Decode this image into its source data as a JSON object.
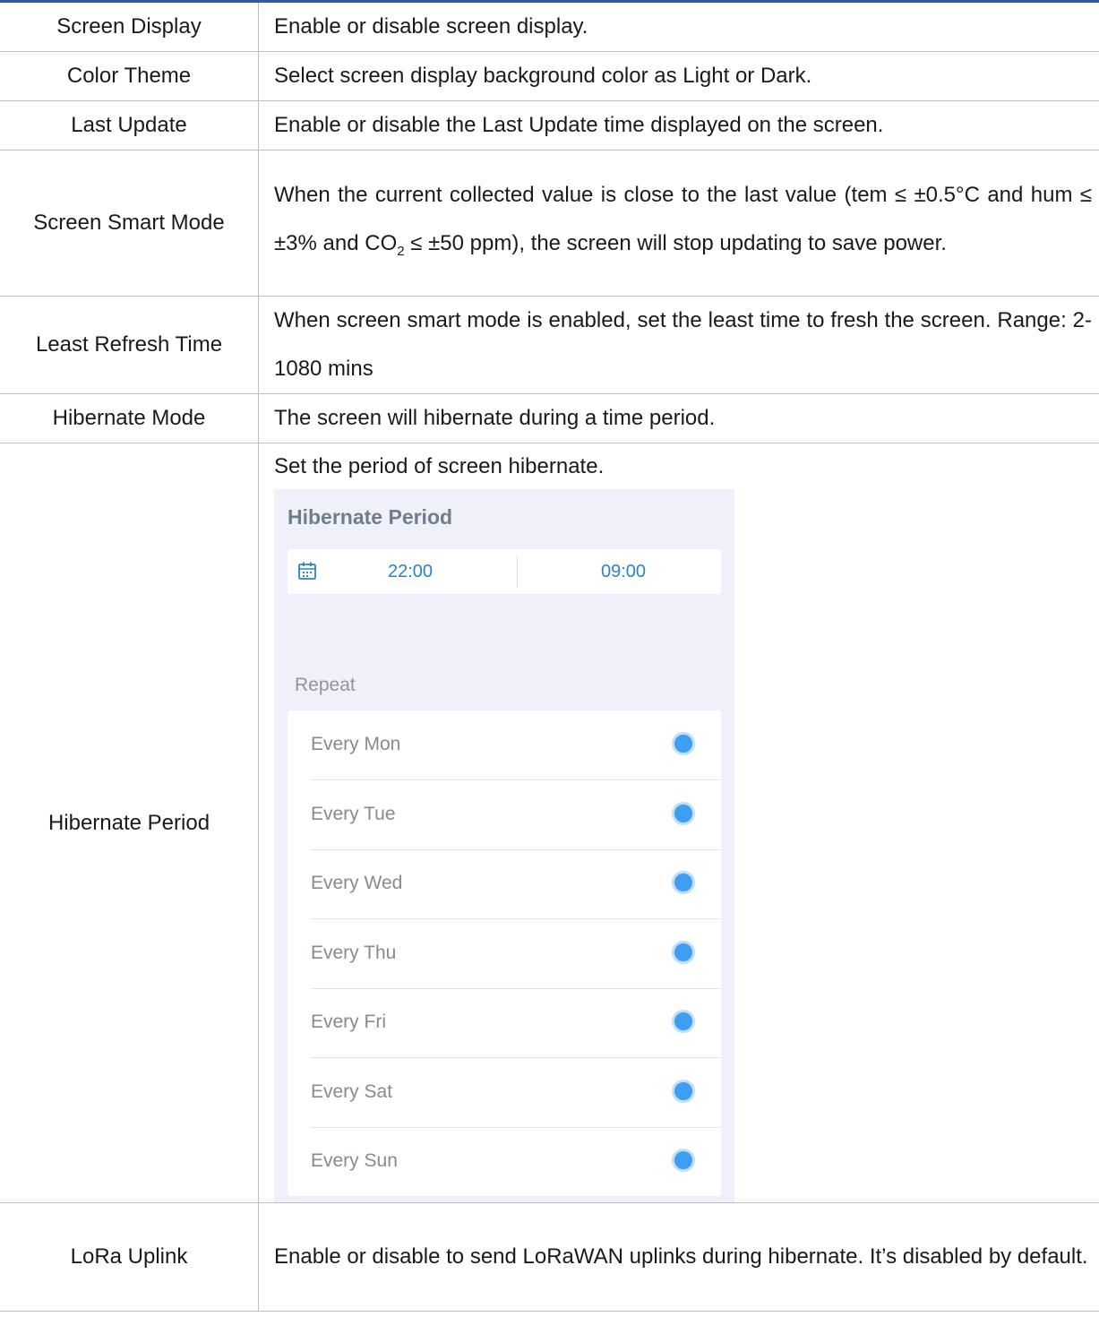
{
  "rows": [
    {
      "name": "Screen Display",
      "desc": "Enable or disable screen display."
    },
    {
      "name": "Color Theme",
      "desc": "Select screen display background color as Light or Dark."
    },
    {
      "name": "Last Update",
      "desc": "Enable or disable the Last Update time displayed on the screen."
    },
    {
      "name": "Screen Smart Mode",
      "desc_before": "When the current collected value is close to the last value (tem ≤ ±0.5°C and hum ≤ ±3% and CO",
      "desc_sub": "2",
      "desc_after": " ≤ ±50 ppm), the screen will stop updating to save power."
    },
    {
      "name": "Least Refresh Time",
      "desc": "When screen smart mode is enabled, set the least time to fresh the screen. Range: 2-1080 mins"
    },
    {
      "name": "Hibernate Mode",
      "desc": "The screen will hibernate during a time period."
    },
    {
      "name": "Hibernate Period",
      "desc": "Set the period of screen hibernate."
    },
    {
      "name": "LoRa Uplink",
      "desc": "Enable or disable to send LoRaWAN uplinks during hibernate. It’s disabled by default."
    }
  ],
  "app": {
    "title": "Hibernate Period",
    "start_time": "22:00",
    "end_time": "09:00",
    "repeat_label": "Repeat",
    "days": [
      {
        "label": "Every Mon",
        "selected": true
      },
      {
        "label": "Every Tue",
        "selected": true
      },
      {
        "label": "Every Wed",
        "selected": true
      },
      {
        "label": "Every Thu",
        "selected": true
      },
      {
        "label": "Every Fri",
        "selected": true
      },
      {
        "label": "Every Sat",
        "selected": true
      },
      {
        "label": "Every Sun",
        "selected": true
      }
    ],
    "accent_color": "#3f9df2",
    "time_color": "#2c84c4"
  }
}
